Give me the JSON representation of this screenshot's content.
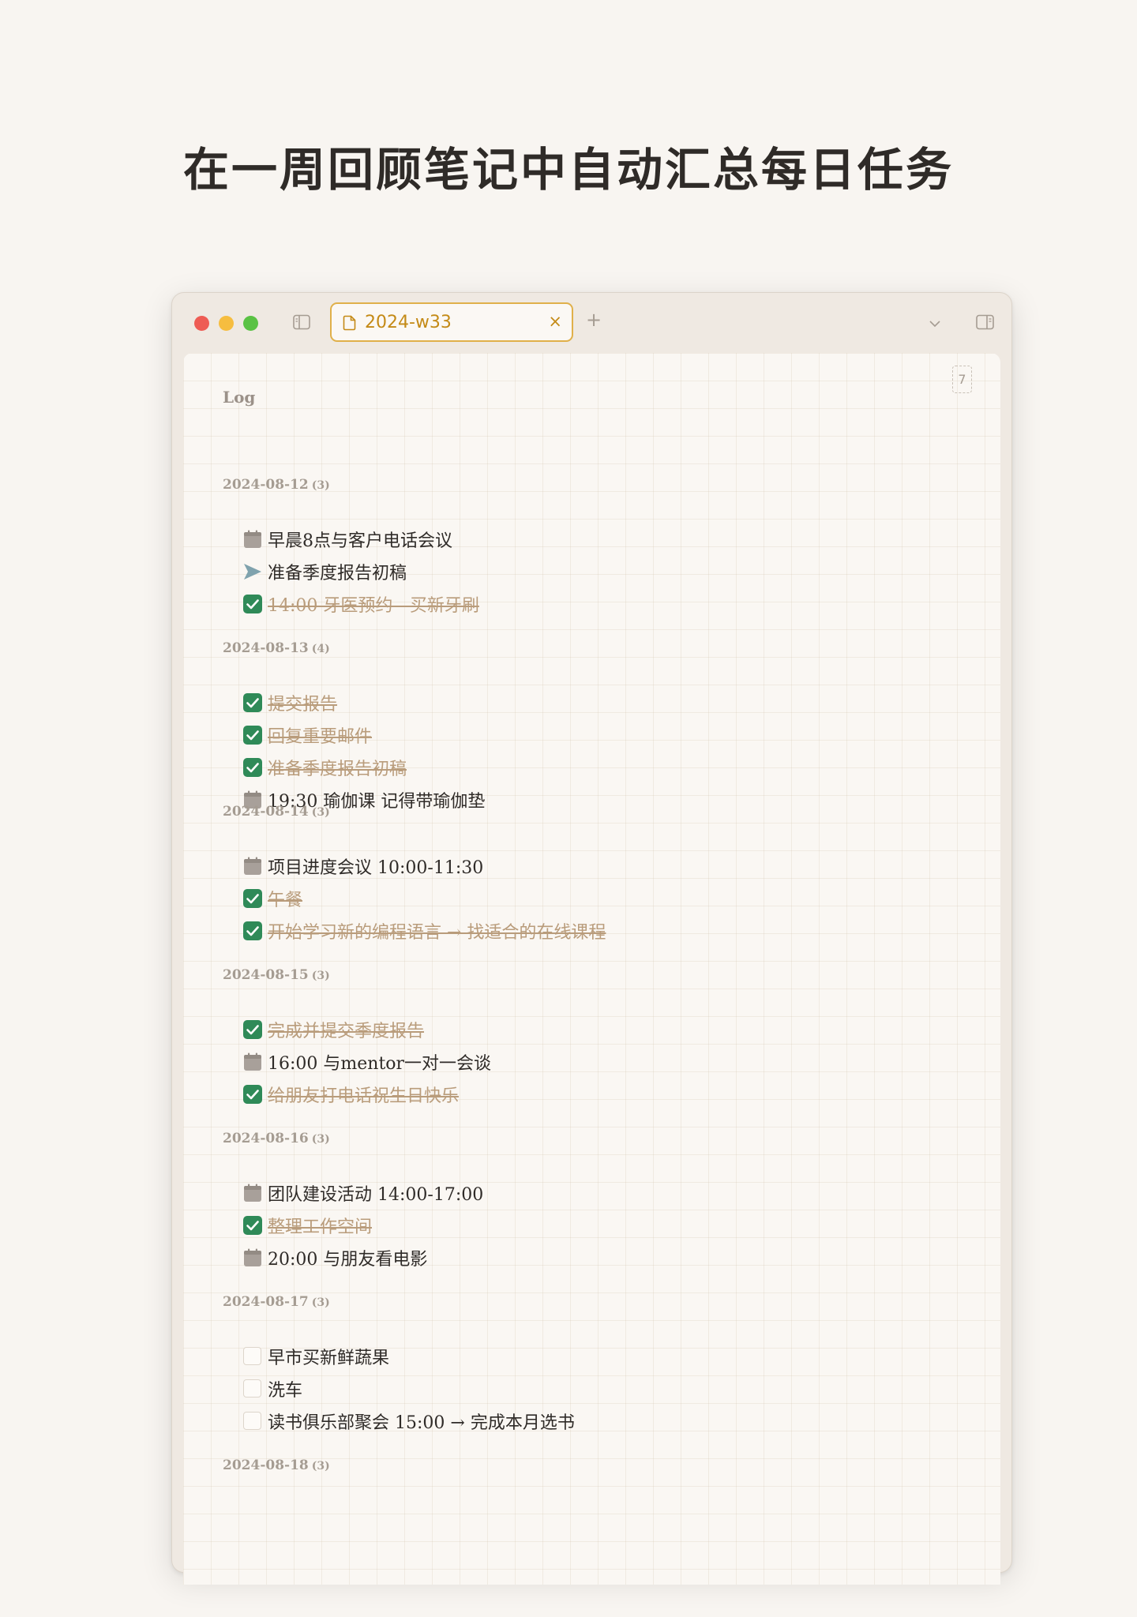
{
  "headline": "在一周回顾笔记中自动汇总每日任务",
  "tab": {
    "title": "2024-w33",
    "close": "×"
  },
  "new_tab": "+",
  "badge": "7",
  "log_heading": "Log",
  "days": [
    {
      "date": "2024-08-12",
      "count": "(3)",
      "tasks": [
        {
          "status": "scheduled",
          "text": "早晨8点与客户电话会议"
        },
        {
          "status": "forwarded",
          "text": "准备季度报告初稿"
        },
        {
          "status": "done",
          "text": "14:00 牙医预约 - 买新牙刷"
        }
      ]
    },
    {
      "date": "2024-08-13",
      "count": "(4)",
      "tasks": [
        {
          "status": "done",
          "text": "提交报告"
        },
        {
          "status": "done",
          "text": "回复重要邮件"
        },
        {
          "status": "done",
          "text": "准备季度报告初稿"
        },
        {
          "status": "scheduled",
          "text": "19:30 瑜伽课 记得带瑜伽垫"
        }
      ]
    },
    {
      "date": "2024-08-14",
      "count": "(3)",
      "tasks": [
        {
          "status": "scheduled",
          "text": "项目进度会议 10:00-11:30"
        },
        {
          "status": "done",
          "text": "午餐"
        },
        {
          "status": "done",
          "text": "开始学习新的编程语言 → 找适合的在线课程"
        }
      ]
    },
    {
      "date": "2024-08-15",
      "count": "(3)",
      "tasks": [
        {
          "status": "done",
          "text": "完成并提交季度报告"
        },
        {
          "status": "scheduled",
          "text": "16:00 与mentor一对一会谈"
        },
        {
          "status": "done",
          "text": "给朋友打电话祝生日快乐"
        }
      ]
    },
    {
      "date": "2024-08-16",
      "count": "(3)",
      "tasks": [
        {
          "status": "scheduled",
          "text": "团队建设活动 14:00-17:00"
        },
        {
          "status": "done",
          "text": "整理工作空间"
        },
        {
          "status": "scheduled",
          "text": "20:00 与朋友看电影"
        }
      ]
    },
    {
      "date": "2024-08-17",
      "count": "(3)",
      "tasks": [
        {
          "status": "open",
          "text": "早市买新鲜蔬果"
        },
        {
          "status": "open",
          "text": "洗车"
        },
        {
          "status": "open",
          "text": "读书俱乐部聚会 15:00 → 完成本月选书"
        }
      ]
    },
    {
      "date": "2024-08-18",
      "count": "(3)",
      "tasks": []
    }
  ],
  "colors": {
    "accent": "#e0b04a",
    "check_green": "#2f8a58",
    "done_text": "#b99c7b",
    "calendar_gray": "#a8a09a",
    "forward_blue": "#7fa2ad"
  }
}
